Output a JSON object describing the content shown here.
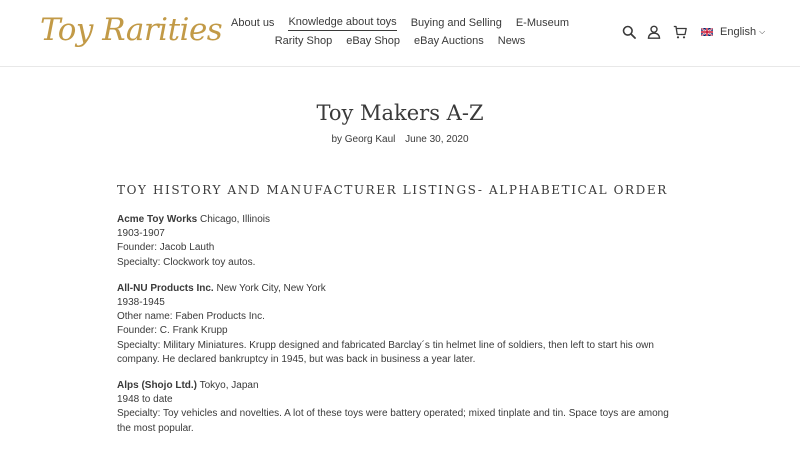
{
  "logo": {
    "text": "Toy Rarities"
  },
  "nav": {
    "row1": [
      {
        "label": "About us",
        "active": false
      },
      {
        "label": "Knowledge about toys",
        "active": true
      },
      {
        "label": "Buying and Selling",
        "active": false
      },
      {
        "label": "E-Museum",
        "active": false
      }
    ],
    "row2": [
      {
        "label": "Rarity Shop"
      },
      {
        "label": "eBay Shop"
      },
      {
        "label": "eBay Auctions"
      },
      {
        "label": "News"
      }
    ]
  },
  "header_icons": {
    "search": "search-icon",
    "account": "user-icon",
    "cart": "cart-icon"
  },
  "language": {
    "label": "English",
    "flag": "uk-flag-icon"
  },
  "article": {
    "title": "Toy Makers A-Z",
    "author": "by Georg Kaul",
    "date": "June 30, 2020",
    "section_heading": "Toy History and Manufacturer Listings- Alphabetical Order",
    "entries": [
      {
        "name": "Acme Toy Works",
        "location": " Chicago, Illinois",
        "lines": [
          "1903-1907",
          "Founder: Jacob Lauth",
          "Specialty: Clockwork toy autos."
        ]
      },
      {
        "name": "All-NU Products Inc.",
        "location": " New York City, New York",
        "lines": [
          "1938-1945",
          "Other name: Faben Products Inc.",
          "Founder: C. Frank Krupp",
          "Specialty: Military Miniatures. Krupp designed and fabricated Barclay´s tin helmet line of soldiers, then left to start his own company. He declared bankruptcy in 1945, but was back in business a year later."
        ]
      },
      {
        "name": "Alps (Shojo Ltd.)",
        "location": " Tokyo, Japan",
        "lines": [
          "1948 to date",
          "Specialty: Toy vehicles and novelties. A lot of these toys were battery operated; mixed tinplate and tin. Space toys are among the most popular."
        ]
      }
    ]
  },
  "colors": {
    "logo_gold": "#c29a47",
    "text": "#3a3a3a",
    "divider": "#e8e8e8"
  }
}
